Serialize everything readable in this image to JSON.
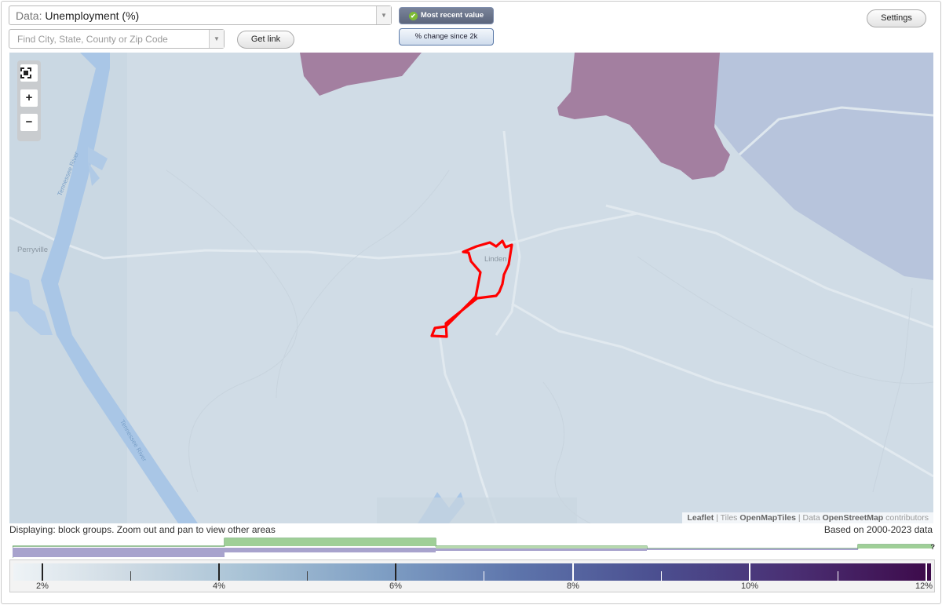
{
  "header": {
    "data_prefix": "Data: ",
    "data_value": "Unemployment (%)",
    "search_placeholder": "Find City, State, County or Zip Code",
    "get_link_label": "Get link",
    "toggle_recent_label": "Most recent value",
    "toggle_change_label": "% change since 2k",
    "settings_label": "Settings"
  },
  "map": {
    "place_labels": [
      "Perryville",
      "Linden"
    ],
    "river_labels": [
      "Tennessee River",
      "Tennessee River"
    ],
    "attribution": {
      "leaflet": "Leaflet",
      "tiles_prefix": " | Tiles ",
      "tiles": "OpenMapTiles",
      "data_prefix": " | Data ",
      "data": "OpenStreetMap",
      "suffix": " contributors"
    },
    "zoom_controls": {
      "fullscreen_icon": "fullscreen-icon",
      "zoom_in": "+",
      "zoom_out": "−"
    },
    "highlight_color": "#ff0000"
  },
  "footer": {
    "displaying_text": "Displaying: block groups. Zoom out and pan to view other areas",
    "based_on_text": "Based on 2000-2023 data",
    "legend_labels": [
      "2%",
      "4%",
      "6%",
      "8%",
      "10%",
      "12%"
    ],
    "help_symbol": "?"
  },
  "colors": {
    "accent_purple": "#a37fa0",
    "water": "#a9c6e6",
    "land": "#d0dce6",
    "histogram_green": "#9fcf97",
    "histogram_blue": "#a8a3cd"
  }
}
